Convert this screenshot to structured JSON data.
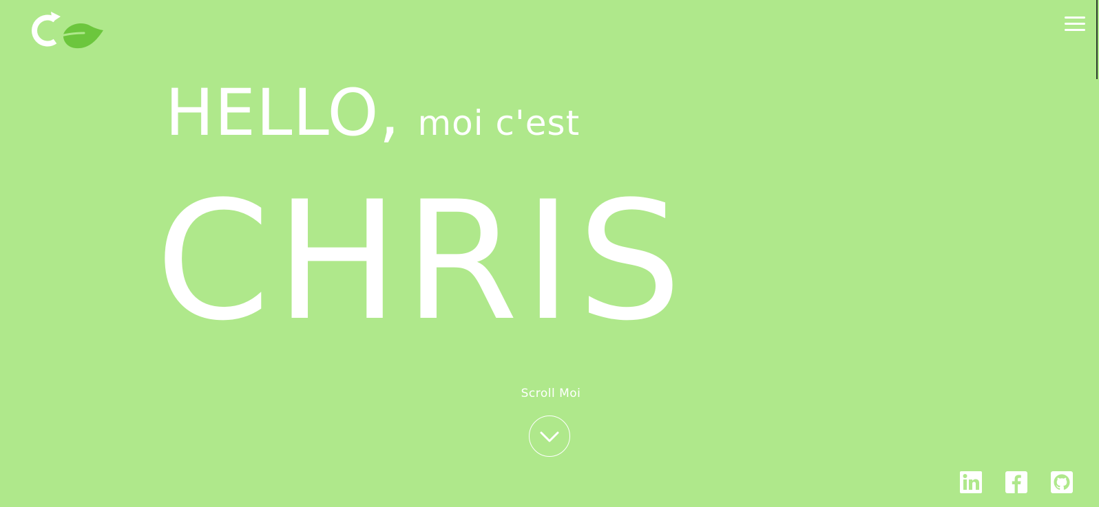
{
  "header": {
    "logo_icon": "co-leaf-logo",
    "menu_icon": "hamburger-menu-icon"
  },
  "hero": {
    "greeting": "HELLO,",
    "intro": "moi c'est",
    "name": "CHRIS"
  },
  "scroll": {
    "label": "Scroll Moi",
    "icon": "chevron-down-icon"
  },
  "social": [
    {
      "name": "LinkedIn",
      "icon": "linkedin-icon"
    },
    {
      "name": "Facebook",
      "icon": "facebook-icon"
    },
    {
      "name": "GitHub",
      "icon": "github-icon"
    }
  ],
  "colors": {
    "background": "#afe88b",
    "text": "#ffffff",
    "leaf": "#6cc63d"
  }
}
